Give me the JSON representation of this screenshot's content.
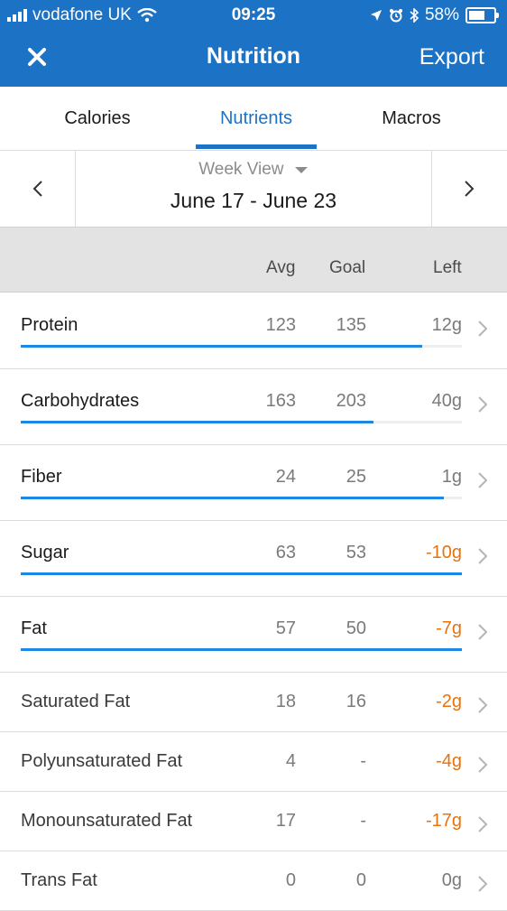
{
  "status_bar": {
    "carrier": "vodafone UK",
    "time": "09:25",
    "battery": "58%"
  },
  "nav": {
    "title": "Nutrition",
    "export_label": "Export",
    "close_icon": "close-icon"
  },
  "tabs": [
    {
      "label": "Calories",
      "active": false
    },
    {
      "label": "Nutrients",
      "active": true
    },
    {
      "label": "Macros",
      "active": false
    }
  ],
  "date_nav": {
    "view_label": "Week View",
    "range": "June 17 - June 23"
  },
  "columns": {
    "avg": "Avg",
    "goal": "Goal",
    "left": "Left"
  },
  "colors": {
    "accent": "#1c72c4",
    "bar": "#1c88e6",
    "over": "#e8720c"
  },
  "nutrients": [
    {
      "name": "Protein",
      "avg": "123",
      "goal": "135",
      "left": "12g",
      "over": false,
      "progress": 0.91
    },
    {
      "name": "Carbohydrates",
      "avg": "163",
      "goal": "203",
      "left": "40g",
      "over": false,
      "progress": 0.8
    },
    {
      "name": "Fiber",
      "avg": "24",
      "goal": "25",
      "left": "1g",
      "over": false,
      "progress": 0.96
    },
    {
      "name": "Sugar",
      "avg": "63",
      "goal": "53",
      "left": "-10g",
      "over": true,
      "progress": 1.0
    },
    {
      "name": "Fat",
      "avg": "57",
      "goal": "50",
      "left": "-7g",
      "over": true,
      "progress": 1.0
    },
    {
      "name": "Saturated Fat",
      "avg": "18",
      "goal": "16",
      "left": "-2g",
      "over": true
    },
    {
      "name": "Polyunsaturated Fat",
      "avg": "4",
      "goal": "-",
      "left": "-4g",
      "over": true
    },
    {
      "name": "Monounsaturated Fat",
      "avg": "17",
      "goal": "-",
      "left": "-17g",
      "over": true
    },
    {
      "name": "Trans Fat",
      "avg": "0",
      "goal": "0",
      "left": "0g",
      "over": false
    }
  ]
}
